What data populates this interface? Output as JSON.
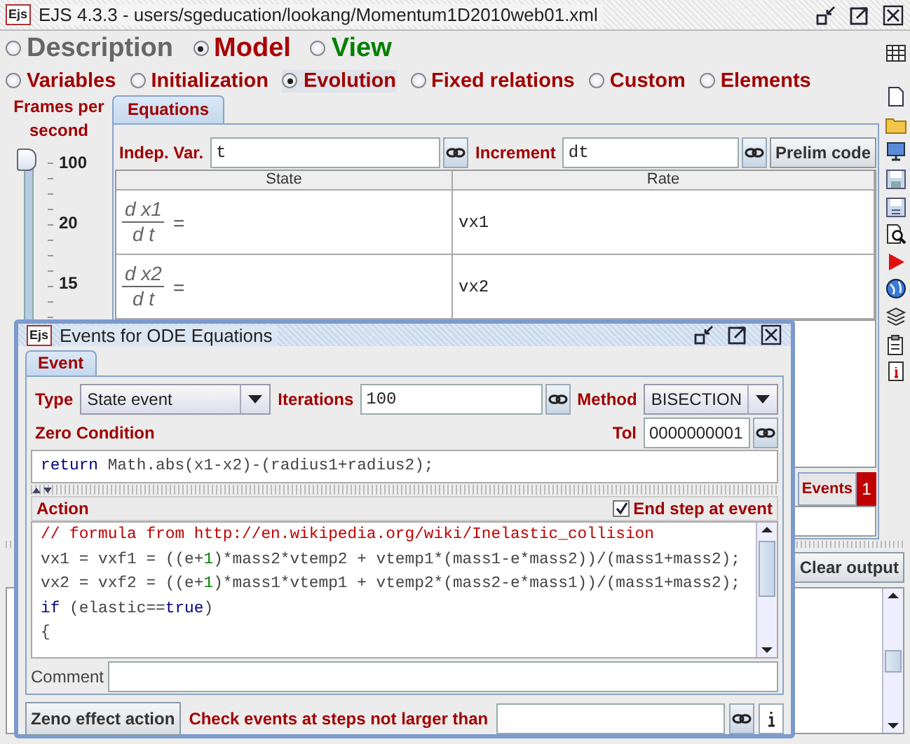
{
  "window": {
    "icon": "Ejs",
    "title": "EJS 4.3.3 - users/sgeducation/lookang/Momentum1D2010web01.xml"
  },
  "panels": [
    {
      "label": "Description",
      "selected": false,
      "color": "#666666"
    },
    {
      "label": "Model",
      "selected": true,
      "color": "#aa0000"
    },
    {
      "label": "View",
      "selected": false,
      "color": "#008000"
    }
  ],
  "sections": [
    {
      "label": "Variables",
      "selected": false
    },
    {
      "label": "Initialization",
      "selected": false
    },
    {
      "label": "Evolution",
      "selected": true
    },
    {
      "label": "Fixed relations",
      "selected": false
    },
    {
      "label": "Custom",
      "selected": false
    },
    {
      "label": "Elements",
      "selected": false
    }
  ],
  "frames": {
    "label": "Frames per second",
    "level": 1,
    "ticks": [
      "100",
      "20",
      "15"
    ]
  },
  "tabs": [
    {
      "label": "Equations",
      "selected": true
    }
  ],
  "indep_var": {
    "label": "Indep. Var.",
    "value": "t"
  },
  "increment": {
    "label": "Increment",
    "value": "dt"
  },
  "prelim_button": "Prelim code",
  "table": {
    "columns": [
      "State",
      "Rate"
    ],
    "rows": [
      {
        "numerator": "d x1",
        "denominator": "d t",
        "equals": "=",
        "rate": "vx1"
      },
      {
        "numerator": "d x2",
        "denominator": "d t",
        "equals": "=",
        "rate": "vx2"
      }
    ]
  },
  "events_tab": {
    "label": "Events",
    "count": "1"
  },
  "clear_output": "Clear output",
  "dialog": {
    "icon": "Ejs",
    "title": "Events for ODE Equations",
    "tabs": [
      {
        "label": "Event",
        "selected": true
      }
    ],
    "type": {
      "label": "Type",
      "value": "State event"
    },
    "iterations": {
      "label": "Iterations",
      "value": "100"
    },
    "method": {
      "label": "Method",
      "value": "BISECTION"
    },
    "zero_condition": {
      "label": "Zero Condition",
      "tol_label": "Tol",
      "tol_value": "0000000001",
      "code": [
        [
          {
            "kind": "keyword",
            "text": "return"
          },
          {
            "kind": "text",
            "text": " Math.abs(x1-x2)-(radius1+radius2);"
          }
        ]
      ]
    },
    "action": {
      "label": "Action",
      "end_step": {
        "label": "End step at event",
        "checked": true
      },
      "code": [
        [
          {
            "kind": "comment",
            "text": "// formula from http://en.wikipedia.org/wiki/Inelastic_collision"
          }
        ],
        [
          {
            "kind": "text",
            "text": "vx1 = vxf1 = ((e+"
          },
          {
            "kind": "number",
            "text": "1"
          },
          {
            "kind": "text",
            "text": ")*mass2*vtemp2 + vtemp1*(mass1-e*mass2))/(mass1+mass2);"
          }
        ],
        [
          {
            "kind": "text",
            "text": "vx2 = vxf2 = ((e+"
          },
          {
            "kind": "number",
            "text": "1"
          },
          {
            "kind": "text",
            "text": ")*mass1*vtemp1 + vtemp2*(mass2-e*mass1))/(mass1+mass2);"
          }
        ],
        [
          {
            "kind": "keyword",
            "text": "if"
          },
          {
            "kind": "text",
            "text": " (elastic=="
          },
          {
            "kind": "keyword",
            "text": "true"
          },
          {
            "kind": "text",
            "text": ")"
          }
        ],
        [
          {
            "kind": "text",
            "text": "{"
          }
        ]
      ]
    },
    "comment": {
      "label": "Comment"
    },
    "zeno_button": "Zeno effect action",
    "check_label": "Check events at steps not larger than"
  }
}
